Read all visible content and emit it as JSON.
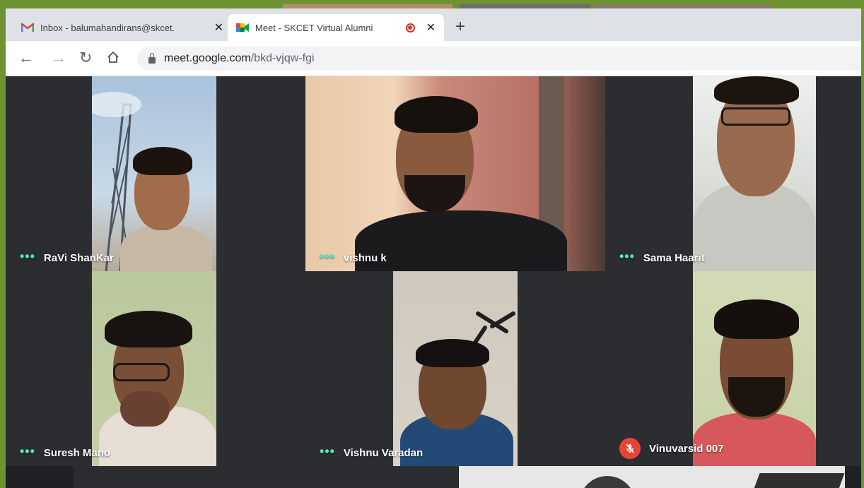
{
  "browser": {
    "tabs": [
      {
        "title": "Inbox - balumahandirans@skcet.",
        "icon": "gmail-icon",
        "active": false
      },
      {
        "title": "Meet - SKCET Virtual Alumni",
        "icon": "meet-icon",
        "active": true,
        "recording": true
      }
    ],
    "new_tab": "+",
    "url_host": "meet.google.com",
    "url_path": "/bkd-vjqw-fgi"
  },
  "participants": [
    {
      "name": "RaVi ShanKar",
      "status": "more-options"
    },
    {
      "name": "vishnu k",
      "status": "more-options"
    },
    {
      "name": "Sama Haarit",
      "status": "more-options"
    },
    {
      "name": "Suresh Mano",
      "status": "more-options"
    },
    {
      "name": "Vishnu Varadan",
      "status": "more-options"
    },
    {
      "name": "Vinuvarsid 007",
      "status": "muted"
    }
  ],
  "colors": {
    "frame": "#6f9232",
    "meet_bg": "#202124",
    "speaking_dots": "#4ee5c4",
    "mute": "#ea4335"
  }
}
